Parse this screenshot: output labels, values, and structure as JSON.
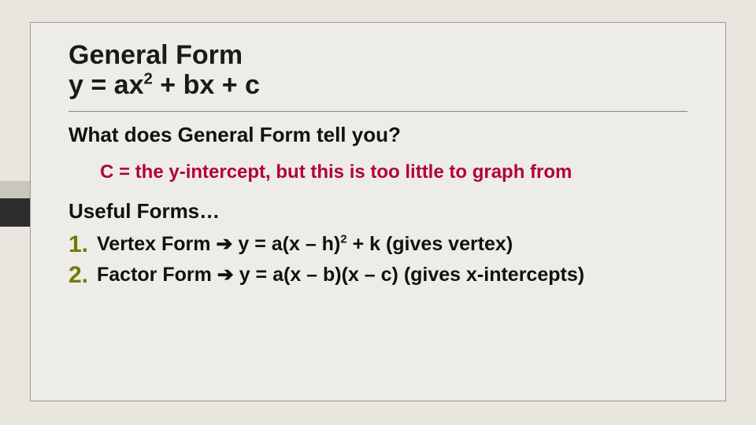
{
  "title_line1": "General Form",
  "title_line2_pre": "y = ax",
  "title_line2_sup": "2",
  "title_line2_post": " + bx + c",
  "question": "What does General Form tell you?",
  "answer": "C = the y-intercept, but this is too little to graph from",
  "useful": "Useful Forms…",
  "items": [
    {
      "num": "1.",
      "pre": "Vertex Form ",
      "arrow": "➔",
      "mid": " y = a(x – h)",
      "sup": "2",
      "post": " + k (gives vertex)"
    },
    {
      "num": "2.",
      "pre": "Factor Form ",
      "arrow": "➔",
      "mid": " y = a(x – b)(x – c) (gives x-intercepts)",
      "sup": "",
      "post": ""
    }
  ]
}
